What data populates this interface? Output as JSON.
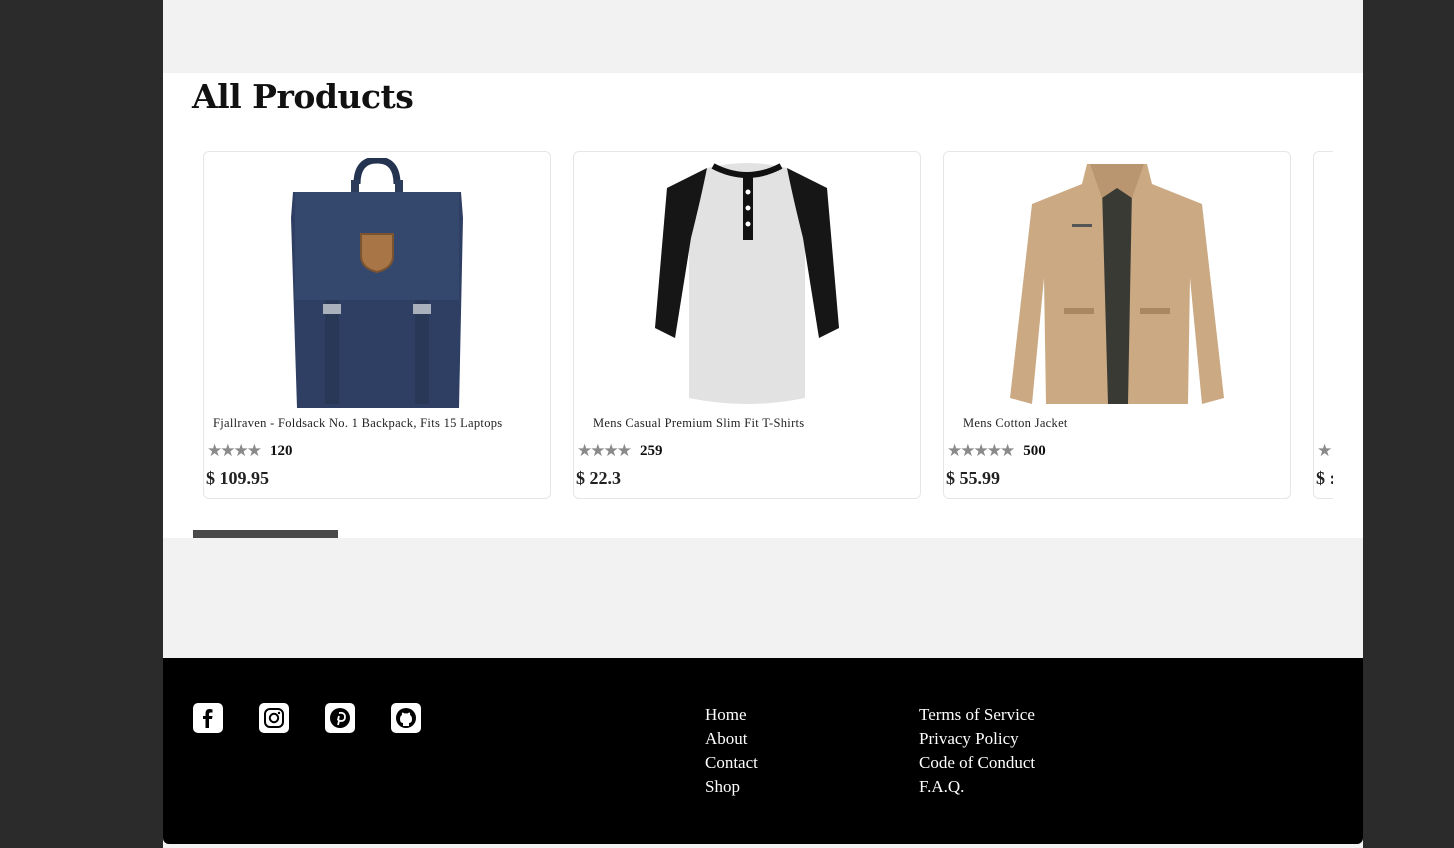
{
  "section": {
    "title": "All Products"
  },
  "products": [
    {
      "name": "Fjallraven - Foldsack No. 1 Backpack, Fits 15 Laptops",
      "stars": "★★★★",
      "rating_count": "120",
      "price": "$ 109.95"
    },
    {
      "name": "Mens Casual Premium Slim Fit T-Shirts",
      "stars": "★★★★",
      "rating_count": "259",
      "price": "$ 22.3"
    },
    {
      "name": "Mens Cotton Jacket",
      "stars": "★★★★★",
      "rating_count": "500",
      "price": "$ 55.99"
    },
    {
      "name": "",
      "stars": "★",
      "rating_count": "",
      "price": "$ :"
    }
  ],
  "social": [
    "facebook-icon",
    "instagram-icon",
    "pinterest-icon",
    "github-icon"
  ],
  "footer": {
    "nav": [
      "Home",
      "About",
      "Contact",
      "Shop"
    ],
    "legal": [
      "Terms of Service",
      "Privacy Policy",
      "Code of Conduct",
      "F.A.Q."
    ]
  }
}
